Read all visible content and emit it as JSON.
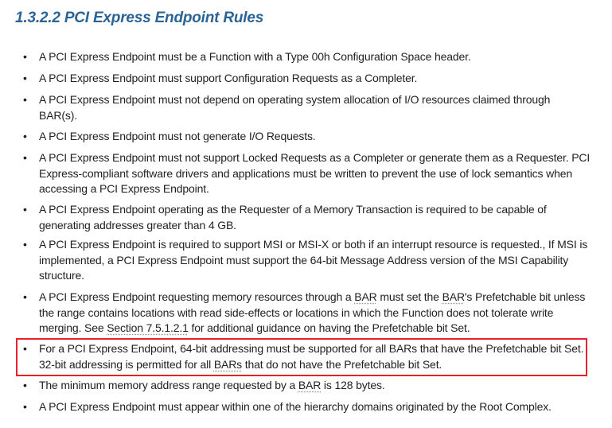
{
  "section": {
    "number": "1.3.2.2",
    "title": "PCI Express Endpoint Rules"
  },
  "bullet_glyph": "•",
  "items": [
    {
      "text": "A PCI Express Endpoint must be a Function with a Type 00h Configuration Space header."
    },
    {
      "text": "A PCI Express Endpoint must support Configuration Requests as a Completer."
    },
    {
      "text": "A PCI Express Endpoint must not depend on operating system allocation of I/O resources claimed through BAR(s)."
    },
    {
      "text": "A PCI Express Endpoint must not generate I/O Requests."
    },
    {
      "text": "A PCI Express Endpoint must not support Locked Requests as a Completer or generate them as a Requester. PCI Express-compliant software drivers and applications must be written to prevent the use of lock semantics when accessing a PCI Express Endpoint."
    },
    {
      "text": "A PCI Express Endpoint operating as the Requester of a Memory Transaction is required to be capable of generating addresses greater than 4 GB."
    },
    {
      "text": "A PCI Express Endpoint is required to support MSI or MSI-X or both if an interrupt resource is requested., If MSI is implemented, a PCI Express Endpoint must support the 64-bit Message Address version of the MSI Capability structure."
    },
    {
      "p1": "A PCI Express Endpoint requesting memory resources through a ",
      "t1": "BAR",
      "p2": " must set the ",
      "t2": "BAR",
      "p3": "'s Prefetchable bit unless the range contains locations with read side-effects or locations in which the Function does not tolerate write merging. See ",
      "link": "Section 7.5.1.2.1",
      "p4": " for additional guidance on having the Prefetchable bit Set."
    },
    {
      "p1": "For a PCI Express Endpoint, 64-bit addressing must be supported for all BARs that have the Prefetchable bit Set. 32-bit addressing is permitted for all ",
      "t1": "BARs",
      "p2": " that do not have the Prefetchable bit Set.",
      "highlighted": true
    },
    {
      "p1": "The minimum memory address range requested by a ",
      "t1": "BAR",
      "p2": " is 128 bytes."
    },
    {
      "text": "A PCI Express Endpoint must appear within one of the hierarchy domains originated by the Root Complex."
    }
  ],
  "colors": {
    "heading": "#2a6496",
    "body_text": "#1f1f1f",
    "highlight_border": "#e8222d"
  }
}
